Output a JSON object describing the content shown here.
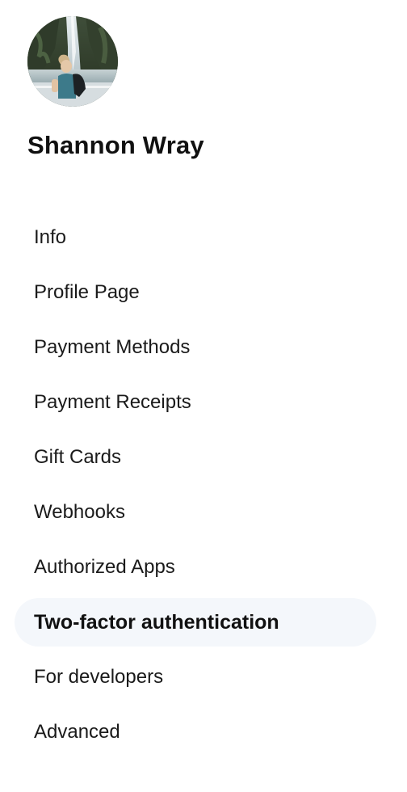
{
  "profile": {
    "avatar_alt": "Profile photo",
    "name": "Shannon Wray"
  },
  "nav": {
    "active_index": 7,
    "items": [
      {
        "label": "Info"
      },
      {
        "label": "Profile Page"
      },
      {
        "label": "Payment Methods"
      },
      {
        "label": "Payment Receipts"
      },
      {
        "label": "Gift Cards"
      },
      {
        "label": "Webhooks"
      },
      {
        "label": "Authorized Apps"
      },
      {
        "label": "Two-factor authentication"
      },
      {
        "label": "For developers"
      },
      {
        "label": "Advanced"
      }
    ]
  },
  "colors": {
    "active_background": "#f4f7fb",
    "text": "#1a1a1a",
    "page_background": "#ffffff"
  }
}
